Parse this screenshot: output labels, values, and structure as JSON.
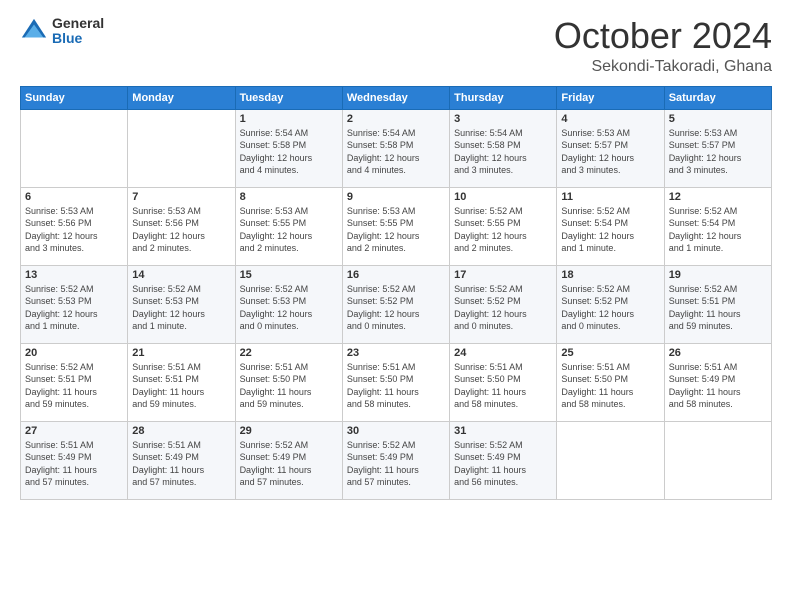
{
  "logo": {
    "general": "General",
    "blue": "Blue"
  },
  "title": {
    "month": "October 2024",
    "location": "Sekondi-Takoradi, Ghana"
  },
  "header": {
    "days": [
      "Sunday",
      "Monday",
      "Tuesday",
      "Wednesday",
      "Thursday",
      "Friday",
      "Saturday"
    ]
  },
  "weeks": [
    {
      "days": [
        {
          "num": "",
          "info": ""
        },
        {
          "num": "",
          "info": ""
        },
        {
          "num": "1",
          "info": "Sunrise: 5:54 AM\nSunset: 5:58 PM\nDaylight: 12 hours\nand 4 minutes."
        },
        {
          "num": "2",
          "info": "Sunrise: 5:54 AM\nSunset: 5:58 PM\nDaylight: 12 hours\nand 4 minutes."
        },
        {
          "num": "3",
          "info": "Sunrise: 5:54 AM\nSunset: 5:58 PM\nDaylight: 12 hours\nand 3 minutes."
        },
        {
          "num": "4",
          "info": "Sunrise: 5:53 AM\nSunset: 5:57 PM\nDaylight: 12 hours\nand 3 minutes."
        },
        {
          "num": "5",
          "info": "Sunrise: 5:53 AM\nSunset: 5:57 PM\nDaylight: 12 hours\nand 3 minutes."
        }
      ]
    },
    {
      "days": [
        {
          "num": "6",
          "info": "Sunrise: 5:53 AM\nSunset: 5:56 PM\nDaylight: 12 hours\nand 3 minutes."
        },
        {
          "num": "7",
          "info": "Sunrise: 5:53 AM\nSunset: 5:56 PM\nDaylight: 12 hours\nand 2 minutes."
        },
        {
          "num": "8",
          "info": "Sunrise: 5:53 AM\nSunset: 5:55 PM\nDaylight: 12 hours\nand 2 minutes."
        },
        {
          "num": "9",
          "info": "Sunrise: 5:53 AM\nSunset: 5:55 PM\nDaylight: 12 hours\nand 2 minutes."
        },
        {
          "num": "10",
          "info": "Sunrise: 5:52 AM\nSunset: 5:55 PM\nDaylight: 12 hours\nand 2 minutes."
        },
        {
          "num": "11",
          "info": "Sunrise: 5:52 AM\nSunset: 5:54 PM\nDaylight: 12 hours\nand 1 minute."
        },
        {
          "num": "12",
          "info": "Sunrise: 5:52 AM\nSunset: 5:54 PM\nDaylight: 12 hours\nand 1 minute."
        }
      ]
    },
    {
      "days": [
        {
          "num": "13",
          "info": "Sunrise: 5:52 AM\nSunset: 5:53 PM\nDaylight: 12 hours\nand 1 minute."
        },
        {
          "num": "14",
          "info": "Sunrise: 5:52 AM\nSunset: 5:53 PM\nDaylight: 12 hours\nand 1 minute."
        },
        {
          "num": "15",
          "info": "Sunrise: 5:52 AM\nSunset: 5:53 PM\nDaylight: 12 hours\nand 0 minutes."
        },
        {
          "num": "16",
          "info": "Sunrise: 5:52 AM\nSunset: 5:52 PM\nDaylight: 12 hours\nand 0 minutes."
        },
        {
          "num": "17",
          "info": "Sunrise: 5:52 AM\nSunset: 5:52 PM\nDaylight: 12 hours\nand 0 minutes."
        },
        {
          "num": "18",
          "info": "Sunrise: 5:52 AM\nSunset: 5:52 PM\nDaylight: 12 hours\nand 0 minutes."
        },
        {
          "num": "19",
          "info": "Sunrise: 5:52 AM\nSunset: 5:51 PM\nDaylight: 11 hours\nand 59 minutes."
        }
      ]
    },
    {
      "days": [
        {
          "num": "20",
          "info": "Sunrise: 5:52 AM\nSunset: 5:51 PM\nDaylight: 11 hours\nand 59 minutes."
        },
        {
          "num": "21",
          "info": "Sunrise: 5:51 AM\nSunset: 5:51 PM\nDaylight: 11 hours\nand 59 minutes."
        },
        {
          "num": "22",
          "info": "Sunrise: 5:51 AM\nSunset: 5:50 PM\nDaylight: 11 hours\nand 59 minutes."
        },
        {
          "num": "23",
          "info": "Sunrise: 5:51 AM\nSunset: 5:50 PM\nDaylight: 11 hours\nand 58 minutes."
        },
        {
          "num": "24",
          "info": "Sunrise: 5:51 AM\nSunset: 5:50 PM\nDaylight: 11 hours\nand 58 minutes."
        },
        {
          "num": "25",
          "info": "Sunrise: 5:51 AM\nSunset: 5:50 PM\nDaylight: 11 hours\nand 58 minutes."
        },
        {
          "num": "26",
          "info": "Sunrise: 5:51 AM\nSunset: 5:49 PM\nDaylight: 11 hours\nand 58 minutes."
        }
      ]
    },
    {
      "days": [
        {
          "num": "27",
          "info": "Sunrise: 5:51 AM\nSunset: 5:49 PM\nDaylight: 11 hours\nand 57 minutes."
        },
        {
          "num": "28",
          "info": "Sunrise: 5:51 AM\nSunset: 5:49 PM\nDaylight: 11 hours\nand 57 minutes."
        },
        {
          "num": "29",
          "info": "Sunrise: 5:52 AM\nSunset: 5:49 PM\nDaylight: 11 hours\nand 57 minutes."
        },
        {
          "num": "30",
          "info": "Sunrise: 5:52 AM\nSunset: 5:49 PM\nDaylight: 11 hours\nand 57 minutes."
        },
        {
          "num": "31",
          "info": "Sunrise: 5:52 AM\nSunset: 5:49 PM\nDaylight: 11 hours\nand 56 minutes."
        },
        {
          "num": "",
          "info": ""
        },
        {
          "num": "",
          "info": ""
        }
      ]
    }
  ]
}
